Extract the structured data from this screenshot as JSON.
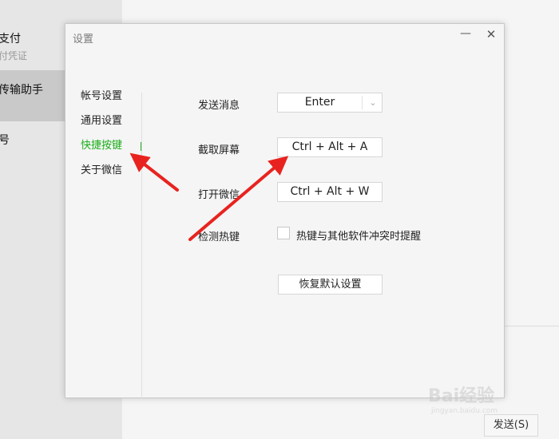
{
  "background": {
    "chat_list": [
      {
        "title": "支付",
        "subtitle": "付凭证"
      },
      {
        "title": "传输助手",
        "subtitle": ""
      },
      {
        "title": "号",
        "subtitle": ""
      }
    ],
    "send_button": "发送(S)"
  },
  "dialog": {
    "title": "设置",
    "minimize_glyph": "—",
    "close_glyph": "✕",
    "nav": [
      {
        "label": "帐号设置",
        "active": false
      },
      {
        "label": "通用设置",
        "active": false
      },
      {
        "label": "快捷按键",
        "active": true
      },
      {
        "label": "关于微信",
        "active": false
      }
    ],
    "shortcuts": {
      "send_message": {
        "label": "发送消息",
        "value": "Enter"
      },
      "screenshot": {
        "label": "截取屏幕",
        "value": "Ctrl + Alt + A"
      },
      "open_wechat": {
        "label": "打开微信",
        "value": "Ctrl + Alt + W"
      },
      "detect_hotkeys": {
        "label": "检测热键",
        "checkbox_label": "热键与其他软件冲突时提醒",
        "checked": false
      }
    },
    "restore_button": "恢复默认设置"
  },
  "watermark": {
    "line1": "Bai经验",
    "line2": "jingyan.baidu.com"
  },
  "colors": {
    "accent_green": "#1aad19",
    "annotation_red": "#e8231f"
  }
}
